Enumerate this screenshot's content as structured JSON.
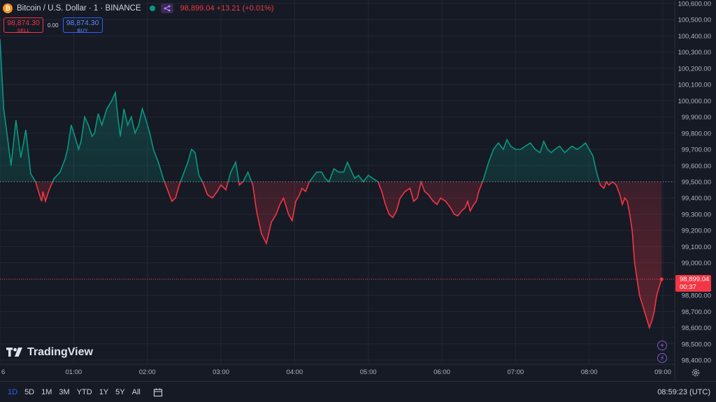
{
  "header": {
    "coin_glyph": "₿",
    "symbol": "Bitcoin / U.S. Dollar · 1 · BINANCE",
    "quote": "98,899.04 +13.21 (+0.01%)"
  },
  "trade": {
    "sell_price": "98,874.30",
    "sell_label": "SELL",
    "spread": "0.00",
    "buy_price": "98,874.30",
    "buy_label": "BUY"
  },
  "brand": {
    "logo_text": "TradingView"
  },
  "price_label": {
    "price": "98,899.04",
    "countdown": "00:37"
  },
  "range_buttons": [
    {
      "label": "1D",
      "active": true
    },
    {
      "label": "5D",
      "active": false
    },
    {
      "label": "1M",
      "active": false
    },
    {
      "label": "3M",
      "active": false
    },
    {
      "label": "YTD",
      "active": false
    },
    {
      "label": "1Y",
      "active": false
    },
    {
      "label": "5Y",
      "active": false
    },
    {
      "label": "All",
      "active": false
    }
  ],
  "clock": "08:59:23 (UTC)",
  "colors": {
    "up": "#089981",
    "down": "#f23645",
    "background": "#161a25",
    "grid": "#232734",
    "text": "#b2b5be"
  },
  "chart_data": {
    "type": "area",
    "baseline": 99500,
    "last_price": 98899.04,
    "ylim": [
      98380,
      100650
    ],
    "y_ticks": [
      98400,
      98500,
      98600,
      98700,
      98800,
      98900,
      99000,
      99100,
      99200,
      99300,
      99400,
      99500,
      99600,
      99700,
      99800,
      99900,
      100000,
      100100,
      100200,
      100300,
      100400,
      100500,
      100600
    ],
    "y_tick_labels": [
      "98,400.00",
      "98,500.00",
      "98,600.00",
      "98,700.00",
      "98,800.00",
      "98,900.00",
      "99,000.00",
      "99,100.00",
      "99,200.00",
      "99,300.00",
      "99,400.00",
      "99,500.00",
      "99,600.00",
      "99,700.00",
      "99,800.00",
      "99,900.00",
      "100,000.00",
      "100,100.00",
      "100,200.00",
      "100,300.00",
      "100,400.00",
      "100,500.00",
      "100,600.00"
    ],
    "xlim": [
      0,
      540
    ],
    "x_ticks": [
      0,
      60,
      120,
      180,
      240,
      300,
      360,
      420,
      480,
      540
    ],
    "x_tick_labels": [
      "6",
      "01:00",
      "02:00",
      "03:00",
      "04:00",
      "05:00",
      "06:00",
      "07:00",
      "08:00",
      "09:00"
    ],
    "series": [
      {
        "x": [
          0,
          3,
          6,
          9,
          13,
          17,
          21,
          25,
          29,
          33,
          34,
          35,
          37,
          40,
          44,
          49,
          53,
          55,
          58,
          61,
          64,
          66,
          69,
          72,
          75,
          77,
          80,
          83,
          87,
          91,
          94,
          96,
          98,
          101,
          104,
          107,
          110,
          113,
          116,
          119,
          122,
          125,
          129,
          133,
          137,
          140,
          143,
          146,
          150,
          153,
          156,
          159,
          162,
          165,
          169,
          173,
          177,
          180,
          184,
          188,
          192,
          195,
          198,
          202,
          206,
          209,
          213,
          217,
          221,
          225,
          228,
          231,
          235,
          238,
          241,
          244,
          246,
          249,
          252,
          255,
          258,
          262,
          265,
          268,
          272,
          276,
          280,
          283,
          286,
          289,
          292,
          296,
          300,
          304,
          308,
          311,
          314,
          317,
          320,
          323,
          326,
          330,
          334,
          337,
          340,
          343,
          346,
          349,
          353,
          356,
          359,
          363,
          367,
          370,
          373,
          376,
          379,
          381,
          383,
          386,
          388,
          390,
          394,
          398,
          402,
          406,
          410,
          413,
          416,
          420,
          424,
          428,
          432,
          436,
          440,
          443,
          446,
          449,
          452,
          456,
          460,
          463,
          466,
          470,
          474,
          477,
          480,
          483,
          486,
          489,
          492,
          494,
          496,
          499,
          502,
          505,
          507,
          509,
          511,
          513,
          515,
          517,
          519,
          521,
          523,
          525,
          527,
          529,
          531,
          533,
          535,
          537,
          539
        ],
        "y": [
          100380,
          99950,
          99780,
          99600,
          99880,
          99650,
          99820,
          99550,
          99500,
          99400,
          99380,
          99440,
          99380,
          99450,
          99520,
          99560,
          99640,
          99700,
          99850,
          99780,
          99700,
          99750,
          99900,
          99850,
          99780,
          99800,
          99920,
          99850,
          99950,
          100000,
          100050,
          99900,
          99780,
          99950,
          99850,
          99900,
          99800,
          99850,
          99950,
          99880,
          99800,
          99700,
          99620,
          99520,
          99440,
          99380,
          99400,
          99480,
          99560,
          99620,
          99700,
          99680,
          99540,
          99500,
          99420,
          99400,
          99440,
          99480,
          99450,
          99560,
          99620,
          99480,
          99500,
          99560,
          99480,
          99320,
          99180,
          99120,
          99250,
          99300,
          99360,
          99400,
          99300,
          99260,
          99380,
          99420,
          99460,
          99440,
          99500,
          99530,
          99560,
          99560,
          99520,
          99500,
          99580,
          99560,
          99560,
          99620,
          99570,
          99520,
          99540,
          99500,
          99540,
          99520,
          99500,
          99440,
          99360,
          99300,
          99280,
          99320,
          99400,
          99440,
          99460,
          99380,
          99400,
          99500,
          99440,
          99420,
          99380,
          99360,
          99400,
          99380,
          99340,
          99300,
          99290,
          99320,
          99340,
          99380,
          99320,
          99360,
          99380,
          99440,
          99520,
          99620,
          99700,
          99740,
          99700,
          99760,
          99720,
          99700,
          99700,
          99720,
          99740,
          99700,
          99680,
          99750,
          99700,
          99680,
          99700,
          99720,
          99680,
          99700,
          99720,
          99700,
          99720,
          99740,
          99700,
          99660,
          99560,
          99480,
          99460,
          99500,
          99480,
          99500,
          99480,
          99420,
          99360,
          99400,
          99380,
          99300,
          99200,
          99000,
          98900,
          98800,
          98750,
          98700,
          98650,
          98600,
          98640,
          98700,
          98800,
          98850,
          98899
        ]
      }
    ]
  }
}
